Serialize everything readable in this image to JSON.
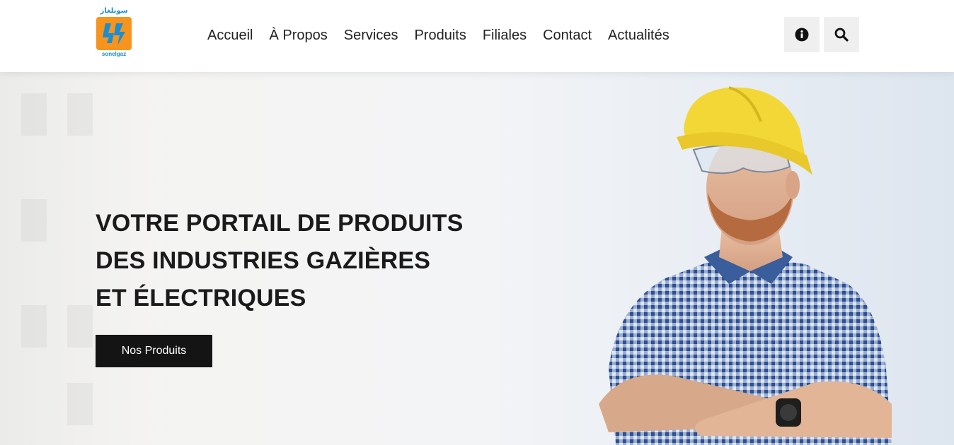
{
  "brand": {
    "arabic_name": "سونلغاز",
    "latin_name": "sonelgaz",
    "colors": {
      "logo_orange": "#f6941d",
      "logo_blue": "#1b8ed1"
    }
  },
  "nav": {
    "items": [
      {
        "label": "Accueil"
      },
      {
        "label": "À Propos"
      },
      {
        "label": "Services"
      },
      {
        "label": "Produits"
      },
      {
        "label": "Filiales"
      },
      {
        "label": "Contact"
      },
      {
        "label": "Actualités"
      }
    ]
  },
  "header_actions": {
    "info_icon": "info-circle-icon",
    "search_icon": "search-icon"
  },
  "hero": {
    "title_lines": [
      "VOTRE PORTAIL DE PRODUITS",
      "DES INDUSTRIES GAZIÈRES",
      "ET ÉLECTRIQUES"
    ],
    "cta_label": "Nos Produits",
    "image": "worker-with-yellow-hard-hat"
  },
  "colors": {
    "text_dark": "#1a1a1a",
    "button_bg": "#141414",
    "icon_button_bg": "#efefef"
  }
}
